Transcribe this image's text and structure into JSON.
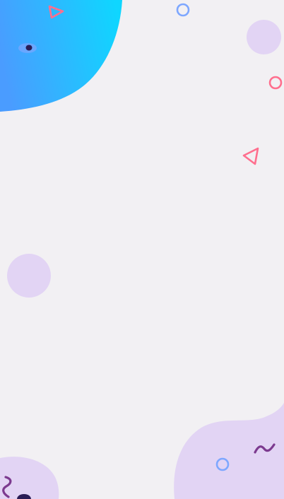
{
  "screen": {
    "background": "#f2f0f3",
    "description_text": ""
  },
  "colors": {
    "gradient_start": "#4a9cff",
    "gradient_end": "#0fd6ff",
    "lavender": "#e2d4f4",
    "pink_accent": "#ff6f8e",
    "blue_accent": "#7ea7ff",
    "purple_squiggle": "#7c3a8f",
    "dark_navy": "#2a1c55"
  },
  "decorations": {
    "top_left_blob": "gradient-blob",
    "eye_icon": "eye-icon",
    "triangle_top": "triangle-outline-icon",
    "ring_top": "ring-outline-icon",
    "circle_top_right": "lavender-circle",
    "ring_right": "ring-outline-icon",
    "triangle_right": "triangle-outline-icon",
    "circle_mid_left": "lavender-circle",
    "bottom_right_blob": "lavender-blob",
    "squiggle_bottom_right": "squiggle-icon",
    "ring_bottom": "ring-outline-icon",
    "bottom_left_blob": "lavender-blob",
    "squiggle_bottom_left": "squiggle-icon",
    "dot_bottom_left": "dot-icon"
  }
}
